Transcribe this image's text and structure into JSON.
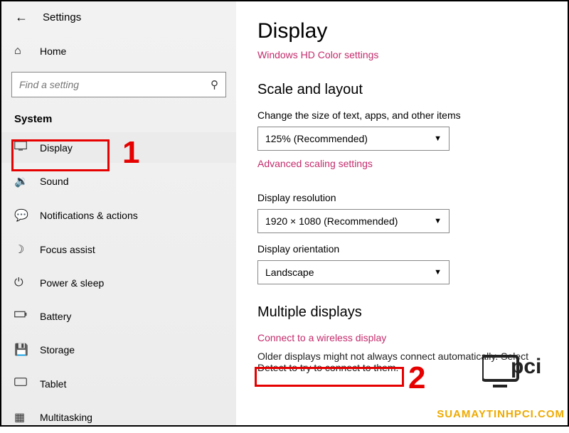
{
  "header": {
    "title": "Settings"
  },
  "home": {
    "label": "Home"
  },
  "search": {
    "placeholder": "Find a setting"
  },
  "section": "System",
  "nav": [
    {
      "label": "Display",
      "icon": "display"
    },
    {
      "label": "Sound",
      "icon": "sound"
    },
    {
      "label": "Notifications & actions",
      "icon": "notifications"
    },
    {
      "label": "Focus assist",
      "icon": "focus"
    },
    {
      "label": "Power & sleep",
      "icon": "power"
    },
    {
      "label": "Battery",
      "icon": "battery"
    },
    {
      "label": "Storage",
      "icon": "storage"
    },
    {
      "label": "Tablet",
      "icon": "tablet"
    },
    {
      "label": "Multitasking",
      "icon": "multi"
    }
  ],
  "annotation1": "1",
  "annotation2": "2",
  "main": {
    "title": "Display",
    "hdLink": "Windows HD Color settings",
    "scale": {
      "heading": "Scale and layout",
      "sizeLabel": "Change the size of text, apps, and other items",
      "sizeValue": "125% (Recommended)",
      "advLink": "Advanced scaling settings",
      "resLabel": "Display resolution",
      "resValue": "1920 × 1080 (Recommended)",
      "orientLabel": "Display orientation",
      "orientValue": "Landscape"
    },
    "multi": {
      "heading": "Multiple displays",
      "connectLink": "Connect to a wireless display",
      "oldText": "Older displays might not always connect automatically. Select Detect to try to connect to them."
    }
  },
  "watermark": {
    "text": "SUAMAYTINHPCI.COM"
  }
}
